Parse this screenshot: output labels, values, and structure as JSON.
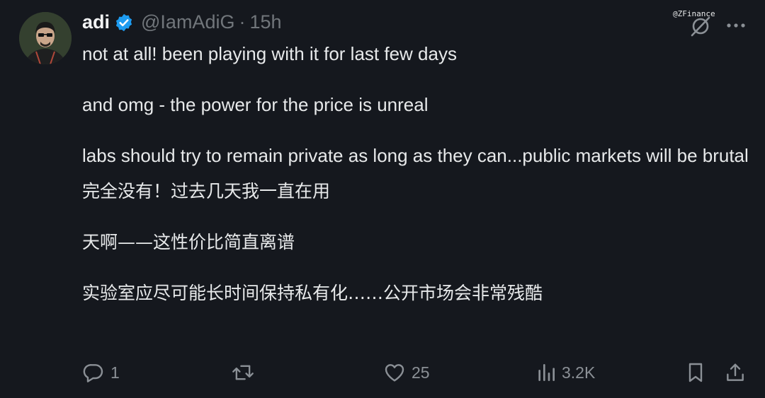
{
  "watermark": "@ZFinance",
  "author": {
    "name": "adi",
    "handle": "@IamAdiG",
    "separator": "·",
    "time": "15h"
  },
  "tweet": {
    "english": [
      "not at all! been playing with it for last few days",
      "and omg - the power for the price is unreal",
      "labs should try to remain private as long as they can...public markets will be brutal"
    ],
    "translation": [
      "完全没有！过去几天我一直在用",
      "天啊——这性价比简直离谱",
      "实验室应尽可能长时间保持私有化……公开市场会非常残酷"
    ]
  },
  "actions": {
    "replies": "1",
    "retweets": "",
    "likes": "25",
    "views": "3.2K"
  },
  "colors": {
    "background": "#15181e",
    "text": "#e7e9ea",
    "muted": "#71767b",
    "verified": "#1d9bf0"
  },
  "icons": [
    "verified-badge-icon",
    "grok-icon",
    "more-icon",
    "reply-icon",
    "retweet-icon",
    "like-icon",
    "views-icon",
    "bookmark-icon",
    "share-icon"
  ]
}
